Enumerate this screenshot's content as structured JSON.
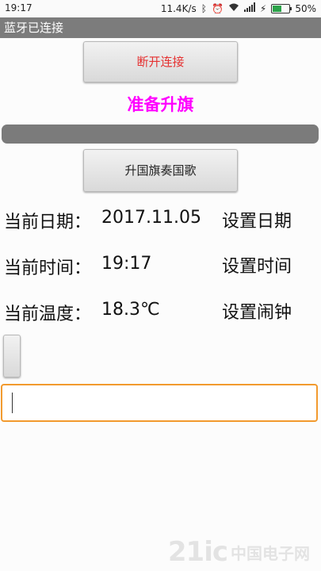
{
  "status": {
    "time": "19:17",
    "network_speed": "11.4K/s",
    "battery_pct": "50%",
    "battery_level": 0.5,
    "icons": [
      "bluetooth-icon",
      "alarm-icon",
      "wifi-icon",
      "signal-icon",
      "charging-icon",
      "battery-icon"
    ]
  },
  "title": "蓝牙已连接",
  "buttons": {
    "disconnect": "断开连接",
    "raise_flag": "升国旗奏国歌"
  },
  "status_text": "准备升旗",
  "progress": {
    "value": 0
  },
  "rows": [
    {
      "label": "当前日期：",
      "value": "2017.11.05",
      "action": "设置日期"
    },
    {
      "label": "当前时间：",
      "value": "19:17",
      "action": "设置时间"
    },
    {
      "label": "当前温度：",
      "value": "18.3℃",
      "action": "设置闹钟"
    }
  ],
  "input": {
    "value": "",
    "placeholder": ""
  },
  "watermark": {
    "logo": "21ic",
    "text": "中国电子网"
  },
  "colors": {
    "accent": "#ff00ff",
    "disconnect": "#e53030",
    "input_border": "#f29a2e",
    "titlebar": "#7c7c7c"
  }
}
